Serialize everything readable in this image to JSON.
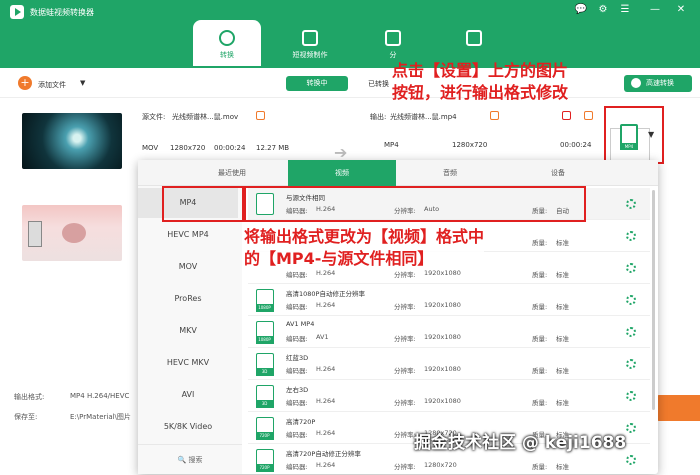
{
  "app": {
    "title": "数据蛙视频转换器"
  },
  "window_controls": [
    "💬",
    "⚙",
    "☰",
    "—",
    "✕"
  ],
  "tabs": [
    {
      "label": "转换",
      "icon": "convert-icon"
    },
    {
      "label": "短视频制作",
      "icon": "short-video-icon"
    },
    {
      "label": "分",
      "icon": "split-icon"
    },
    {
      "label": "",
      "icon": "toolbox-icon"
    }
  ],
  "toolbar": {
    "add_file": "添加文件",
    "converting": "转换中",
    "converted": "已转换",
    "fast_convert": "高速转换"
  },
  "items": [
    {
      "source_label": "源文件:",
      "source_name": "光线频谱林...鼠.mov",
      "format": "MOV",
      "resolution": "1280x720",
      "duration": "00:00:24",
      "size": "12.27 MB",
      "output_label": "输出:",
      "output_name": "光线频谱林...鼠.mp4",
      "out_format": "MP4",
      "out_resolution": "1280x720",
      "out_duration": "00:00:24"
    }
  ],
  "panel": {
    "tabs": [
      "最近使用",
      "视频",
      "音频",
      "设备"
    ],
    "formats": [
      "MP4",
      "HEVC MP4",
      "MOV",
      "ProRes",
      "MKV",
      "HEVC MKV",
      "AVI",
      "5K/8K Video"
    ],
    "search": "搜索",
    "presets": [
      {
        "name": "与源文件相同",
        "encoder_label": "编码器:",
        "encoder": "H.264",
        "res_label": "分辨率:",
        "res": "Auto",
        "quality_label": "质量:",
        "quality": "自动",
        "badge": ""
      },
      {
        "name": "",
        "encoder_label": "",
        "encoder": "",
        "res_label": "",
        "res": "",
        "quality_label": "质量:",
        "quality": "标准",
        "badge": ""
      },
      {
        "name": "",
        "encoder_label": "编码器:",
        "encoder": "H.264",
        "res_label": "分辨率:",
        "res": "1920x1080",
        "quality_label": "质量:",
        "quality": "标准",
        "badge": ""
      },
      {
        "name": "高清1080P自动修正分辨率",
        "encoder_label": "编码器:",
        "encoder": "H.264",
        "res_label": "分辨率:",
        "res": "1920x1080",
        "quality_label": "质量:",
        "quality": "标准",
        "badge": "1080P"
      },
      {
        "name": "AV1 MP4",
        "encoder_label": "编码器:",
        "encoder": "AV1",
        "res_label": "分辨率:",
        "res": "1920x1080",
        "quality_label": "质量:",
        "quality": "标准",
        "badge": "1080P"
      },
      {
        "name": "红蓝3D",
        "encoder_label": "编码器:",
        "encoder": "H.264",
        "res_label": "分辨率:",
        "res": "1920x1080",
        "quality_label": "质量:",
        "quality": "标准",
        "badge": "3D"
      },
      {
        "name": "左右3D",
        "encoder_label": "编码器:",
        "encoder": "H.264",
        "res_label": "分辨率:",
        "res": "1920x1080",
        "quality_label": "质量:",
        "quality": "标准",
        "badge": "3D"
      },
      {
        "name": "高清720P",
        "encoder_label": "编码器:",
        "encoder": "H.264",
        "res_label": "分辨率:",
        "res": "1280x720",
        "quality_label": "质量:",
        "quality": "标准",
        "badge": "720P"
      },
      {
        "name": "高清720P自动修正分辨率",
        "encoder_label": "编码器:",
        "encoder": "H.264",
        "res_label": "分辨率:",
        "res": "1280x720",
        "quality_label": "质量:",
        "quality": "标准",
        "badge": "720P"
      }
    ]
  },
  "bottom": {
    "output_format_label": "输出格式:",
    "output_format": "MP4 H.264/HEVC",
    "save_label": "保存至:",
    "save_path": "E:\\PrMaterial\\图片"
  },
  "annotations": {
    "callout1_line1": "点击【设置】上方的图片",
    "callout1_line2": "按钮，进行输出格式修改",
    "callout2_line1": "将输出格式更改为【视频】格式中",
    "callout2_line2": "的【MP4-与源文件相同】"
  },
  "watermark": "掘金技术社区 @ keji1688",
  "colors": {
    "brand": "#1fa567",
    "accent": "#f07a2c",
    "annotation": "#e02020"
  }
}
